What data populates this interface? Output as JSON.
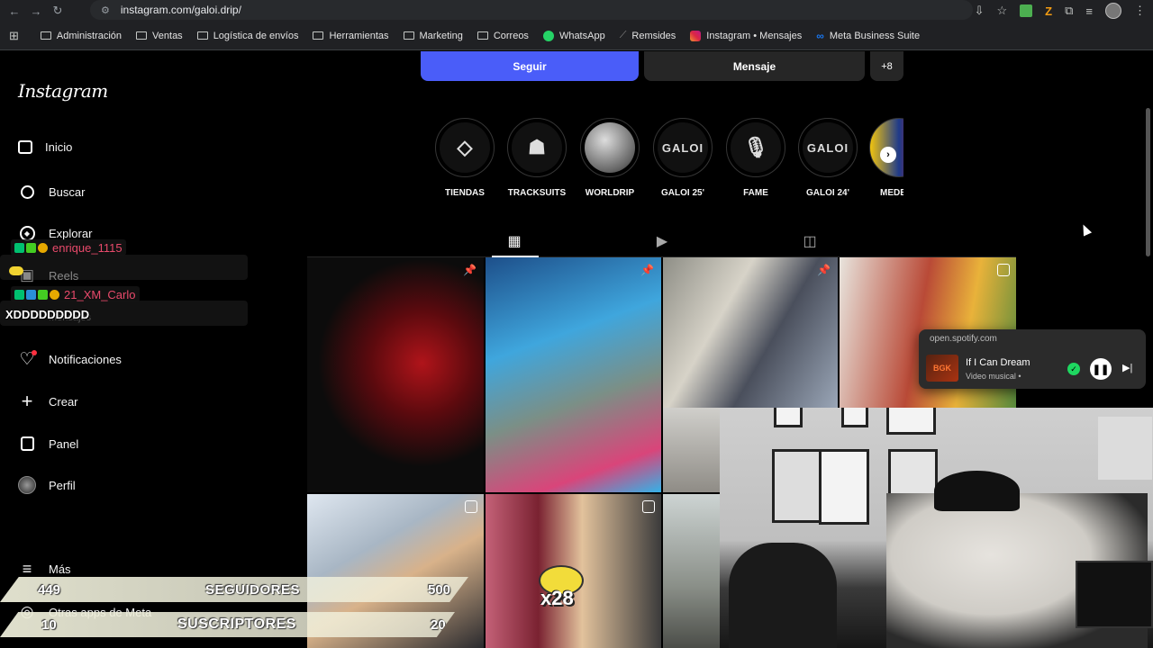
{
  "browser": {
    "url": "instagram.com/galoi.drip/",
    "bookmarks": [
      "Administración",
      "Ventas",
      "Logística de envíos",
      "Herramientas",
      "Marketing",
      "Correos",
      "WhatsApp",
      "Remsides",
      "Instagram • Mensajes",
      "Meta Business Suite"
    ]
  },
  "instagram": {
    "logo": "Instagram",
    "nav": [
      "Inicio",
      "Buscar",
      "Explorar",
      "Reels",
      "Mensajes",
      "Notificaciones",
      "Crear",
      "Panel",
      "Perfil",
      "Más",
      "Otras apps de Meta"
    ],
    "buttons": {
      "follow": "Seguir",
      "message": "Mensaje",
      "add": "+8"
    },
    "highlights": [
      {
        "label": "TIENDAS",
        "icon": "diamond-icon"
      },
      {
        "label": "TRACKSUITS",
        "icon": "tracksuit-icon"
      },
      {
        "label": "WORLDRIP",
        "icon": "globe-icon"
      },
      {
        "label": "GALOI 25'",
        "text": "GALOI"
      },
      {
        "label": "FAME",
        "icon": "microphone-icon"
      },
      {
        "label": "GALOI 24'",
        "text": "GALOI"
      },
      {
        "label": "MEDE"
      }
    ]
  },
  "stream": {
    "chat": [
      {
        "user": "enrique_1115"
      },
      {
        "user": "21_XM_Carlo",
        "message": "XDDDDDDDDD"
      }
    ],
    "counters": [
      {
        "current": "449",
        "label": "SEGUIDORES",
        "goal": "500"
      },
      {
        "current": "10",
        "label": "SUSCRIPTORES",
        "goal": "20"
      }
    ],
    "overlay": "x28"
  },
  "spotify": {
    "source": "open.spotify.com",
    "song": "If I Can Dream",
    "subtitle": "Video musical •",
    "cover": "BGK"
  }
}
